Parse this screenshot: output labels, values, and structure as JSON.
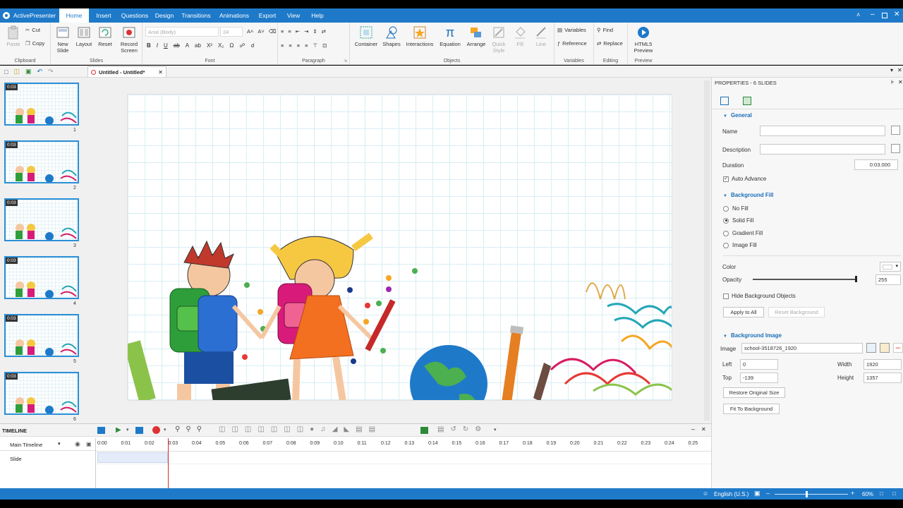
{
  "app": {
    "title": "ActivePresenter"
  },
  "menu": [
    "Home",
    "Insert",
    "Questions",
    "Design",
    "Transitions",
    "Animations",
    "Export",
    "View",
    "Help"
  ],
  "ribbon": {
    "clipboard": {
      "paste": "Paste",
      "cut": "Cut",
      "copy": "Copy",
      "label": "Clipboard"
    },
    "slides": {
      "new_slide": "New Slide",
      "layout": "Layout",
      "reset": "Reset",
      "record": "Record Screen",
      "label": "Slides"
    },
    "font": {
      "family": "Arial (Body)",
      "size": "24",
      "label": "Font"
    },
    "paragraph": {
      "label": "Paragraph"
    },
    "objects": {
      "container": "Container",
      "shapes": "Shapes",
      "interactions": "Interactions",
      "equation": "Equation",
      "arrange": "Arrange",
      "quick_style": "Quick Style",
      "fill": "Fill",
      "line": "Line",
      "label": "Objects"
    },
    "variables": {
      "variables": "Variables",
      "reference": "Reference",
      "label": "Variables"
    },
    "editing": {
      "find": "Find",
      "replace": "Replace",
      "label": "Editing"
    },
    "preview": {
      "html5": "HTML5 Preview",
      "label": "Preview"
    }
  },
  "doc_tab": {
    "title": "Untitled - Untitled*"
  },
  "slides": [
    {
      "time": "0:03",
      "num": "1"
    },
    {
      "time": "0:03",
      "num": "2"
    },
    {
      "time": "0:03",
      "num": "3"
    },
    {
      "time": "0:03",
      "num": "4"
    },
    {
      "time": "0:03",
      "num": "5"
    },
    {
      "time": "0:03",
      "num": "6"
    }
  ],
  "properties": {
    "header": "PROPERTIES - 6 SLIDES",
    "general": "General",
    "name_label": "Name",
    "name_value": "",
    "description_label": "Description",
    "description_value": "",
    "duration_label": "Duration",
    "duration_value": "0:03.000",
    "auto_advance": "Auto Advance",
    "bg_fill": "Background Fill",
    "no_fill": "No Fill",
    "solid_fill": "Solid Fill",
    "gradient_fill": "Gradient Fill",
    "image_fill": "Image Fill",
    "color_label": "Color",
    "color_value": "#ffffff",
    "opacity_label": "Opacity",
    "opacity_value": "255",
    "hide_bg": "Hide Background Objects",
    "apply_all": "Apply to All",
    "reset_bg": "Reset Background",
    "bg_image": "Background Image",
    "image_label": "Image",
    "image_value": "school-3518726_1920",
    "left_label": "Left",
    "left_value": "0",
    "top_label": "Top",
    "top_value": "-139",
    "width_label": "Width",
    "width_value": "1920",
    "height_label": "Height",
    "height_value": "1357",
    "restore": "Restore Original Size",
    "fit": "Fit To Background"
  },
  "timeline": {
    "title": "TIMELINE",
    "main": "Main Timeline",
    "track": "Slide",
    "ticks": [
      "0:00",
      "0:01",
      "0:02",
      "0:03",
      "0:04",
      "0:05",
      "0:06",
      "0:07",
      "0:08",
      "0:09",
      "0:10",
      "0:11",
      "0:12",
      "0:13",
      "0:14",
      "0:15",
      "0:16",
      "0:17",
      "0:18",
      "0:19",
      "0:20",
      "0:21",
      "0:22",
      "0:23",
      "0:24",
      "0:25"
    ]
  },
  "status": {
    "language": "English (U.S.)",
    "zoom": "60%"
  },
  "colors": {
    "accent": "#1e7ac9",
    "thumb_border": "#2b8fd6",
    "playhead": "#d0342c"
  }
}
